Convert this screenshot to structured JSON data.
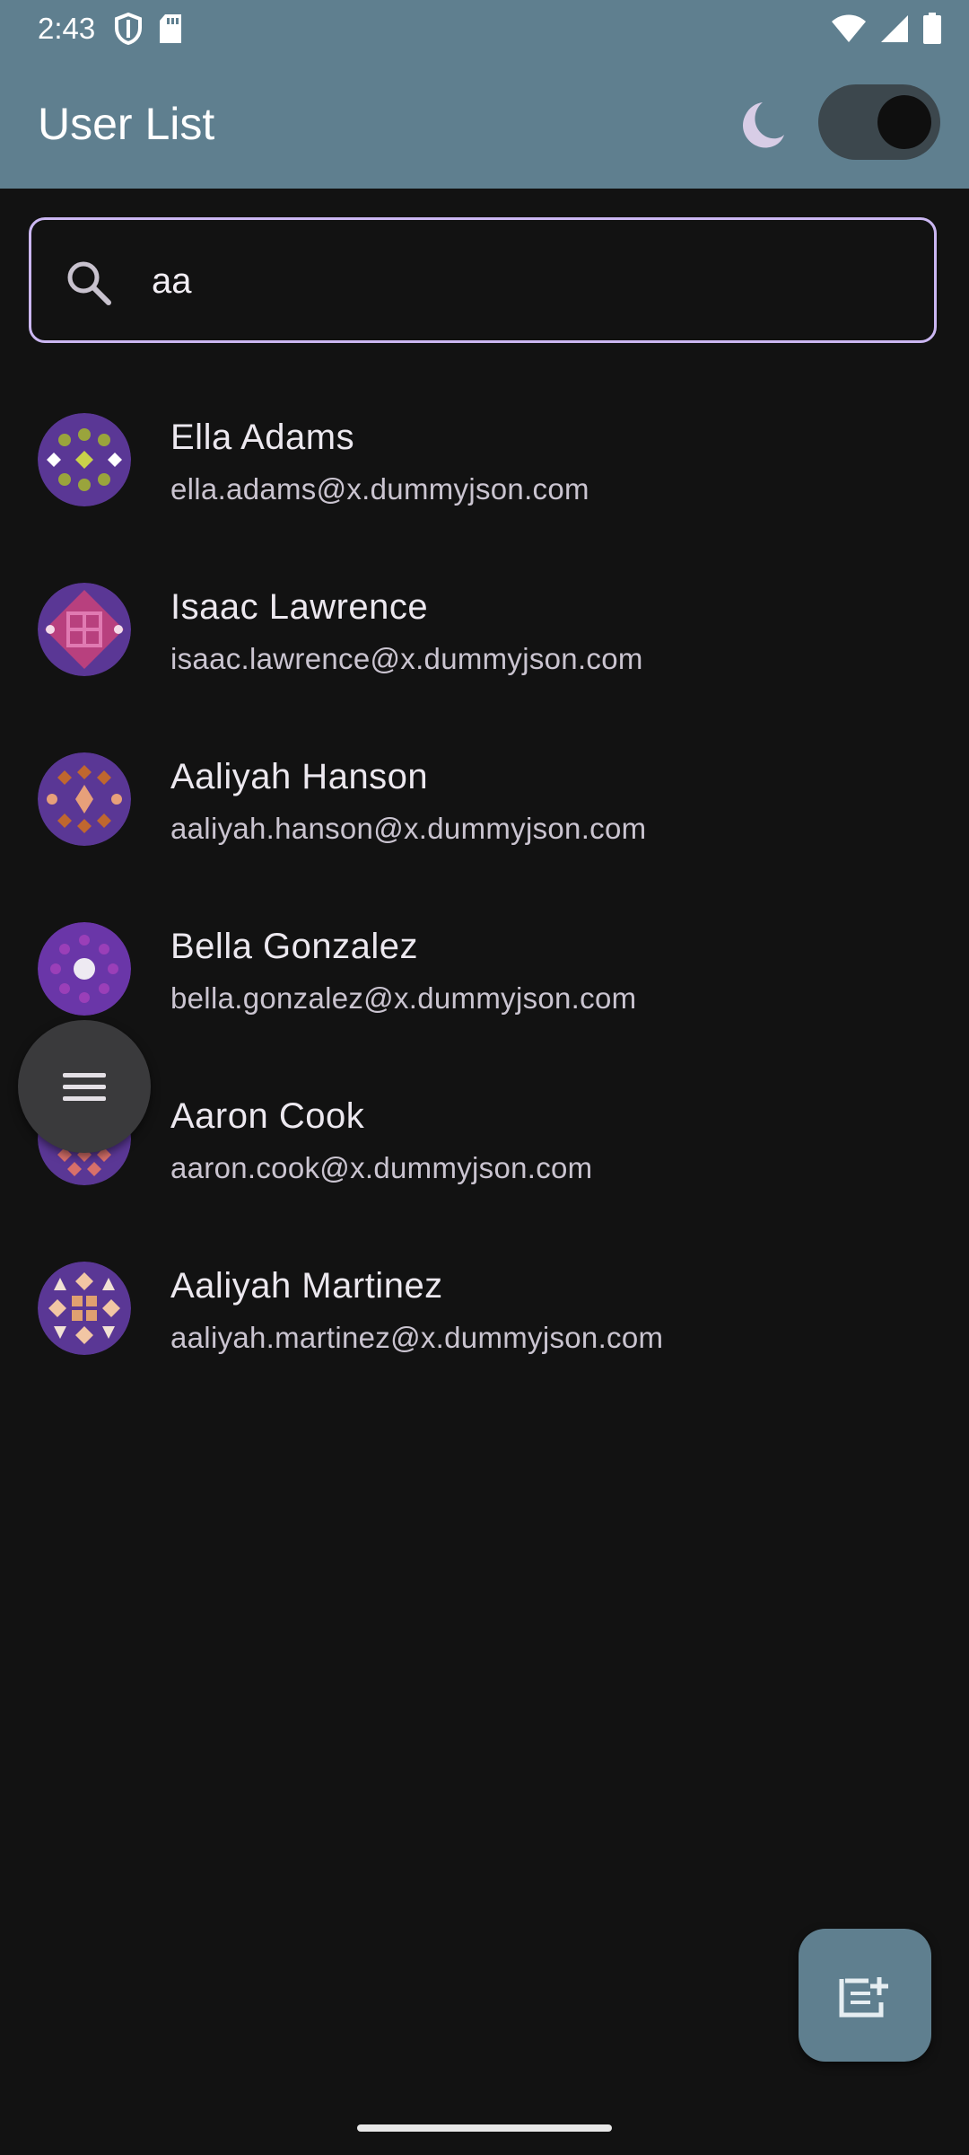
{
  "status_bar": {
    "time": "2:43"
  },
  "app_bar": {
    "title": "User List",
    "theme_toggle_on": true
  },
  "search": {
    "value": "aa"
  },
  "users": [
    {
      "name": "Ella Adams",
      "email": "ella.adams@x.dummyjson.com"
    },
    {
      "name": "Isaac Lawrence",
      "email": "isaac.lawrence@x.dummyjson.com"
    },
    {
      "name": "Aaliyah Hanson",
      "email": "aaliyah.hanson@x.dummyjson.com"
    },
    {
      "name": "Bella Gonzalez",
      "email": "bella.gonzalez@x.dummyjson.com"
    },
    {
      "name": "Aaron Cook",
      "email": "aaron.cook@x.dummyjson.com"
    },
    {
      "name": "Aaliyah Martinez",
      "email": "aaliyah.martinez@x.dummyjson.com"
    }
  ],
  "colors": {
    "app_bar": "#5f7f8f",
    "background": "#121212",
    "search_border": "#cbb7f2",
    "avatar_base": "#5a3795"
  },
  "icons": {
    "status": [
      "shield-icon",
      "sd-card-icon",
      "wifi-icon",
      "signal-icon",
      "battery-icon"
    ],
    "theme": "moon-icon",
    "search": "search-icon",
    "menu_fab": "menu-icon",
    "add_fab": "note-add-icon"
  }
}
